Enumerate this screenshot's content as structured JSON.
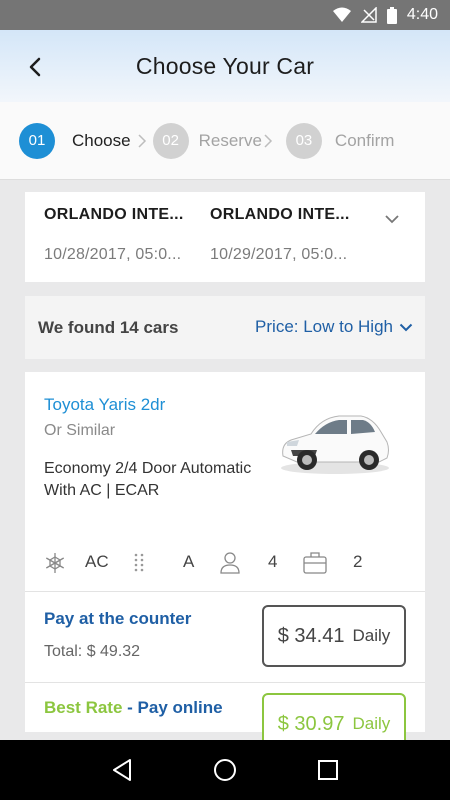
{
  "status_bar": {
    "time": "4:40"
  },
  "header": {
    "title": "Choose Your Car"
  },
  "steps": [
    {
      "number": "01",
      "label": "Choose",
      "active": true
    },
    {
      "number": "02",
      "label": "Reserve",
      "active": false
    },
    {
      "number": "03",
      "label": "Confirm",
      "active": false
    }
  ],
  "locations": {
    "pickup": {
      "name": "ORLANDO INTE...",
      "date": "10/28/2017, 05:0..."
    },
    "dropoff": {
      "name": "ORLANDO INTE...",
      "date": "10/29/2017, 05:0..."
    }
  },
  "results": {
    "found_text": "We found 14 cars",
    "sort_label": "Price: Low to High"
  },
  "car": {
    "name": "Toyota Yaris 2dr",
    "similar": "Or Similar",
    "description": "Economy 2/4 Door Automatic With AC  |  ECAR",
    "features": {
      "ac": "AC",
      "transmission": "A",
      "passengers": "4",
      "bags": "2"
    },
    "pay_counter": {
      "title": "Pay at the counter",
      "total": "Total: $ 49.32",
      "price": "$ 34.41",
      "unit": "Daily"
    },
    "pay_online": {
      "best_label": "Best Rate",
      "separator": " - ",
      "title": "Pay online",
      "price": "$ 30.97",
      "unit": "Daily"
    }
  },
  "colors": {
    "accent": "#1e8fd5",
    "link": "#1f5fa5",
    "best_rate": "#8cc63f"
  }
}
